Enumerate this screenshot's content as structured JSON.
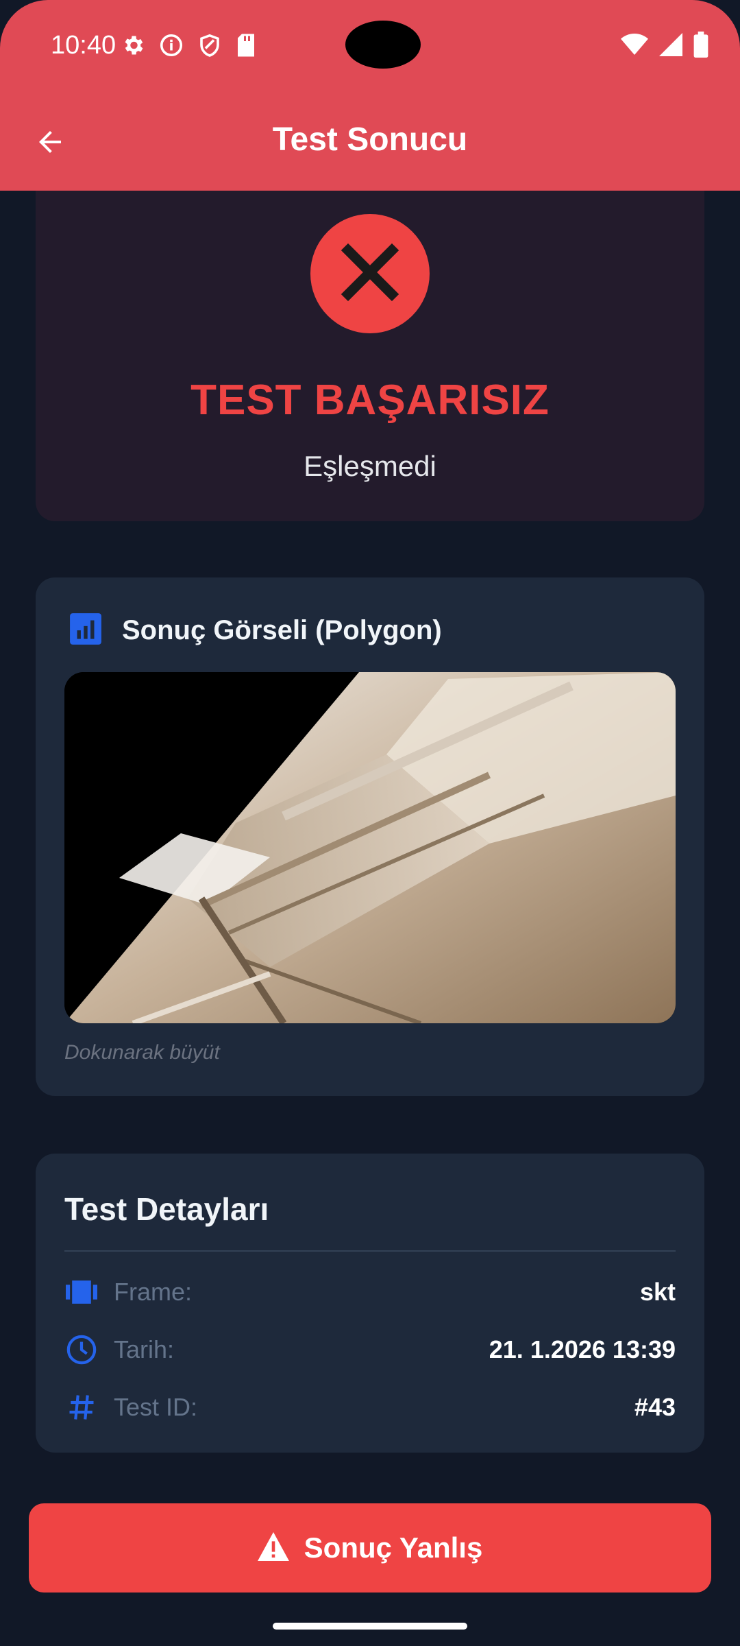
{
  "status_bar": {
    "time": "10:40",
    "icons": [
      "settings-icon",
      "info-icon",
      "shield-icon",
      "sd-card-icon",
      "wifi-icon",
      "signal-icon",
      "battery-icon"
    ]
  },
  "app_bar": {
    "title": "Test Sonucu",
    "back_icon": "arrow-back-icon",
    "color": "#E04A55"
  },
  "result": {
    "icon": "close-icon",
    "title": "TEST BAŞARISIZ",
    "subtitle": "Eşleşmedi",
    "color": "#EF4444"
  },
  "image_section": {
    "icon": "bar-chart-icon",
    "title": "Sonuç Görseli (Polygon)",
    "caption": "Dokunarak büyüt"
  },
  "details": {
    "title": "Test Detayları",
    "rows": [
      {
        "icon": "frame-icon",
        "label": "Frame:",
        "value": "skt"
      },
      {
        "icon": "clock-icon",
        "label": "Tarih:",
        "value": "21. 1.2026 13:39"
      },
      {
        "icon": "hash-icon",
        "label": "Test ID:",
        "value": "#43"
      }
    ]
  },
  "action_button": {
    "icon": "warning-icon",
    "label": "Sonuç Yanlış"
  },
  "colors": {
    "background": "#111827",
    "card": "#1E293B",
    "accent_blue": "#2563EB",
    "danger": "#EF4444"
  }
}
